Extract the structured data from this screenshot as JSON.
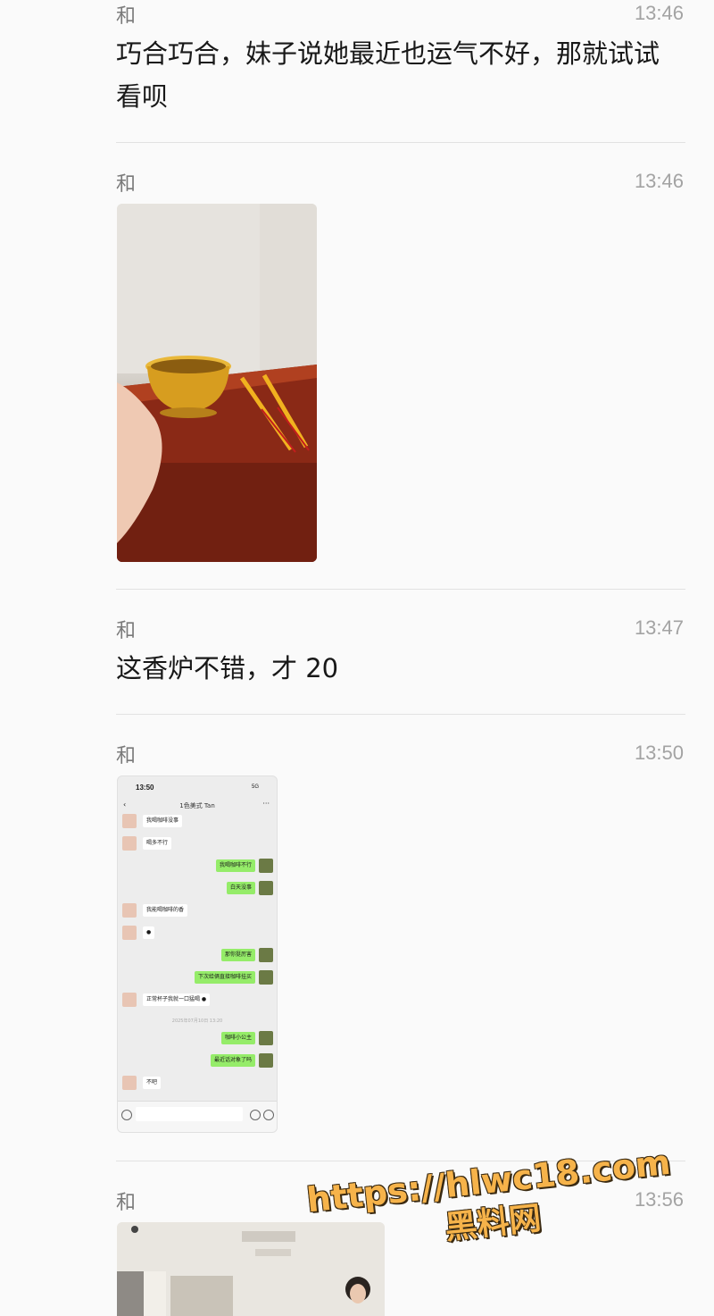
{
  "messages": [
    {
      "sender": "和",
      "time": "13:46",
      "text": "巧合巧合，妹子说她最近也运气不好，那就试试看呗"
    },
    {
      "sender": "和",
      "time": "13:46",
      "image": "photo-incense-burner"
    },
    {
      "sender": "和",
      "time": "13:47",
      "text": "这香炉不错，才 20"
    },
    {
      "sender": "和",
      "time": "13:50",
      "image": "chat-screenshot"
    },
    {
      "sender": "和",
      "time": "13:56",
      "image": "photo-room"
    }
  ],
  "screenshot": {
    "status_time": "13:50",
    "status_right": "5G",
    "title": "1色美式 Tan",
    "bubbles": [
      {
        "side": "in",
        "text": "我喝咖啡没事"
      },
      {
        "side": "in",
        "text": "喝多不行"
      },
      {
        "side": "out",
        "text": "我喝咖啡不行"
      },
      {
        "side": "out",
        "text": "白天没事"
      },
      {
        "side": "in",
        "text": "我能喝咖啡的香"
      },
      {
        "side": "in",
        "text": "●"
      },
      {
        "side": "out",
        "text": "那你挺厉害"
      },
      {
        "side": "out",
        "text": "下次给俩直接咖啡挂买"
      },
      {
        "side": "in",
        "text": "正常杯子我就一口猛喝 ●"
      },
      {
        "side": "sys",
        "text": "2025年07月10日 13:20"
      },
      {
        "side": "out",
        "text": "咖啡小公主"
      },
      {
        "side": "out",
        "text": "最近话对象了吗"
      },
      {
        "side": "in",
        "text": "不吧"
      }
    ]
  },
  "watermark": {
    "url": "https://hlwc18.com",
    "name": "黑料网"
  },
  "colors": {
    "background": "#fafafa",
    "divider": "#e2e2e2",
    "out_bubble": "#95ec69",
    "watermark": "#f6b34a"
  }
}
